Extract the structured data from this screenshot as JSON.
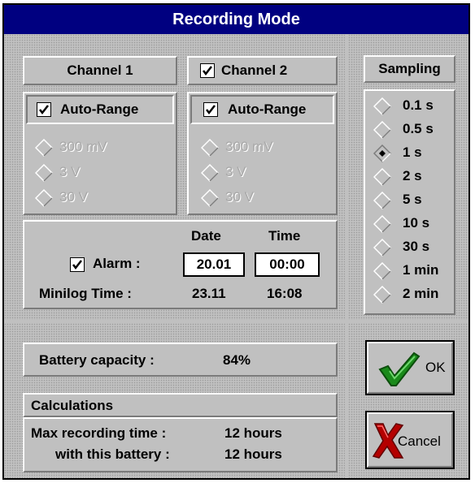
{
  "window": {
    "title": "Recording Mode"
  },
  "channel1": {
    "label": "Channel 1",
    "autorange_label": "Auto-Range",
    "autorange_checked": true,
    "ranges": [
      "300 mV",
      "3 V",
      "30 V"
    ]
  },
  "channel2": {
    "label": "Channel 2",
    "checked": true,
    "autorange_label": "Auto-Range",
    "autorange_checked": true,
    "ranges": [
      "300 mV",
      "3 V",
      "30 V"
    ]
  },
  "sampling": {
    "title": "Sampling",
    "options": [
      "0.1 s",
      "0.5 s",
      "1 s",
      "2 s",
      "5 s",
      "10 s",
      "30 s",
      "1 min",
      "2 min"
    ],
    "selected": "1 s"
  },
  "alarm": {
    "date_header": "Date",
    "time_header": "Time",
    "label": "Alarm :",
    "checked": true,
    "date_value": "20.01",
    "time_value": "00:00",
    "minilog_label": "Minilog Time :",
    "minilog_date": "23.11",
    "minilog_time": "16:08"
  },
  "battery": {
    "label": "Battery capacity :",
    "value": "84%"
  },
  "calculations": {
    "title": "Calculations",
    "max_label": "Max recording time :",
    "max_value": "12 hours",
    "battery_label": "with this battery :",
    "battery_value": "12 hours"
  },
  "buttons": {
    "ok": "OK",
    "cancel": "Cancel"
  },
  "colors": {
    "titlebar": "#000080",
    "face": "#c0c0c0",
    "ok_check": "#1a8a1a",
    "cancel_x": "#b40000"
  }
}
